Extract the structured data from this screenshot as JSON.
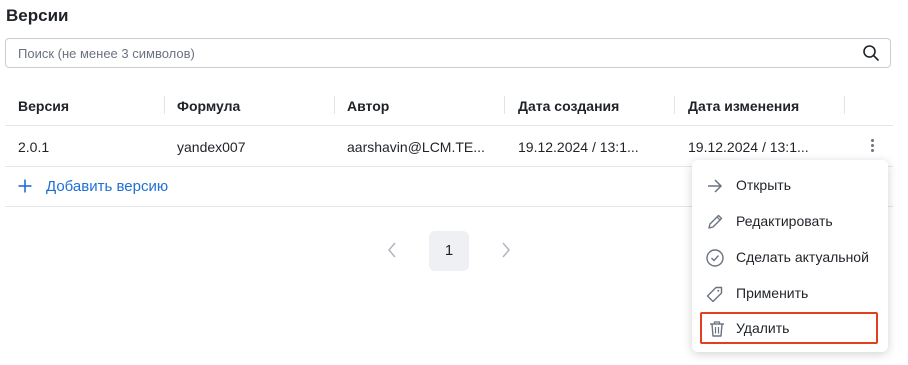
{
  "page": {
    "title": "Версии"
  },
  "search": {
    "placeholder": "Поиск (не менее 3 символов)",
    "value": ""
  },
  "table": {
    "columns": [
      "Версия",
      "Формула",
      "Автор",
      "Дата создания",
      "Дата изменения"
    ],
    "rows": [
      {
        "version": "2.0.1",
        "formula": "yandex007",
        "author": "aarshavin@LCM.TE...",
        "created": "19.12.2024 / 13:1...",
        "modified": "19.12.2024 / 13:1..."
      }
    ]
  },
  "add_version": {
    "label": "Добавить версию"
  },
  "pagination": {
    "current_page": "1"
  },
  "context_menu": {
    "items": [
      {
        "label": "Открыть",
        "icon": "arrow-right-icon"
      },
      {
        "label": "Редактировать",
        "icon": "pencil-icon"
      },
      {
        "label": "Сделать актуальной",
        "icon": "check-circle-icon"
      },
      {
        "label": "Применить",
        "icon": "tag-icon"
      },
      {
        "label": "Удалить",
        "icon": "trash-icon"
      }
    ],
    "highlighted_item": "Удалить"
  },
  "colors": {
    "link": "#1f6fd8",
    "highlight_border": "#e0401f",
    "text": "#1f2328",
    "muted": "#6b7280"
  }
}
